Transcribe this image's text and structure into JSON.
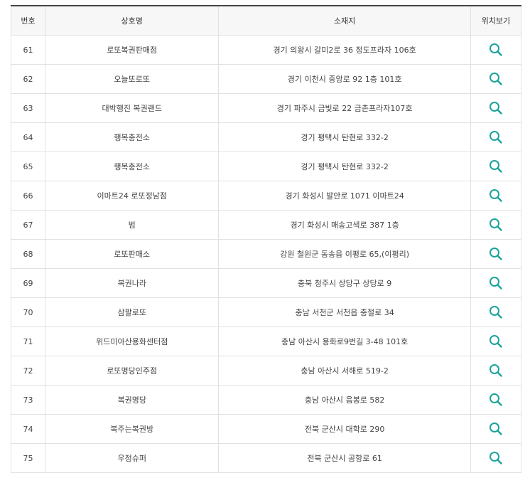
{
  "table": {
    "headers": {
      "no": "번호",
      "name": "상호명",
      "address": "소재지",
      "map": "위치보기"
    },
    "icon": "search-icon",
    "accent_color": "#1aa39a",
    "rows": [
      {
        "no": "61",
        "name": "로또복권판매점",
        "address": "경기 의왕시 갈미2로 36 정도프라자 106호"
      },
      {
        "no": "62",
        "name": "오늘또로또",
        "address": "경기 이천시 중앙로 92 1층 101호"
      },
      {
        "no": "63",
        "name": "대박행진 복권랜드",
        "address": "경기 파주시 금빛로 22 금촌프라자107호"
      },
      {
        "no": "64",
        "name": "행복충전소",
        "address": "경기 평택시 탄현로 332-2"
      },
      {
        "no": "65",
        "name": "행복충전소",
        "address": "경기 평택시 탄현로 332-2"
      },
      {
        "no": "66",
        "name": "이마트24 로또정남점",
        "address": "경기 화성시 발안로 1071 이마트24"
      },
      {
        "no": "67",
        "name": "범",
        "address": "경기 화성시 매송고색로 387 1층"
      },
      {
        "no": "68",
        "name": "로또판매소",
        "address": "강원 철원군 동송읍 이평로 65,(이평리)"
      },
      {
        "no": "69",
        "name": "복권나라",
        "address": "충북 청주시 상당구 상당로 9"
      },
      {
        "no": "70",
        "name": "삼팔로또",
        "address": "충남 서천군 서천읍 충절로 34"
      },
      {
        "no": "71",
        "name": "위드미아산용화센터점",
        "address": "충남 아산시 용화로9번길 3-48 101호"
      },
      {
        "no": "72",
        "name": "로또명당인주점",
        "address": "충남 아산시 서해로 519-2"
      },
      {
        "no": "73",
        "name": "복권명당",
        "address": "충남 아산시 음봉로 582"
      },
      {
        "no": "74",
        "name": "복주는복권방",
        "address": "전북 군산시 대학로 290"
      },
      {
        "no": "75",
        "name": "우정슈퍼",
        "address": "전북 군산시 공항로 61"
      }
    ]
  }
}
